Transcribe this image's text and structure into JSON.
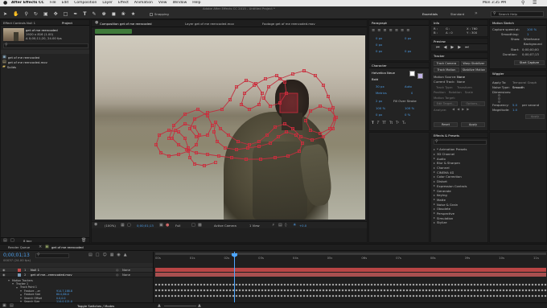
{
  "macbar": {
    "app_name": "After Effects CC",
    "menus": [
      "File",
      "Edit",
      "Composition",
      "Layer",
      "Effect",
      "Animation",
      "View",
      "Window",
      "Help"
    ],
    "clock": "Mon 3:35 PM",
    "window_title": "Adobe After Effects CC 2015 - Untitled Project *"
  },
  "toolbar": {
    "snapping_label": "Snapping",
    "workspaces": [
      "Essentials",
      "Standard"
    ],
    "search_help_placeholder": "Search Help"
  },
  "project_panel": {
    "tabs": [
      "Effect Controls Null 1",
      "Project"
    ],
    "item_name": "get of me reencoded",
    "item_details": [
      "1920 x 816 (1.00)",
      "Δ 0;00;11;20, 24.00 fps"
    ],
    "search_placeholder": "",
    "items": [
      {
        "icon": "comp",
        "name": "get of me reencoded"
      },
      {
        "icon": "footage",
        "name": "get of me reencoded.mov"
      },
      {
        "icon": "folder",
        "name": "Solids"
      }
    ],
    "bpc_label": "8 bpc"
  },
  "viewer": {
    "tabs": [
      "Composition get of me reencoded",
      "Layer get of me reencoded.mov",
      "Footage get of me reencoded.mov"
    ],
    "comp_chip": "get of me reencoded",
    "footer": {
      "zoom": "(100%)",
      "timecode": "0;00;01;13",
      "resolution": "Full",
      "camera": "Active Camera",
      "views": "1 View",
      "exposure": "+0.0"
    },
    "ruler_ticks": [
      "00s",
      "02s",
      "04s",
      "06s",
      "08s",
      "10s"
    ]
  },
  "paragraph_panel": {
    "title": "Paragraph",
    "fields": [
      "0 px",
      "0 px",
      "0 px",
      "0 px",
      "0 px"
    ]
  },
  "character_panel": {
    "title": "Character",
    "font": "Helvetica Neue",
    "style": "Bold",
    "size": "30 px",
    "leading": "Auto",
    "tracking": "Metrics",
    "tracking2": "0",
    "stroke": "2 px",
    "stroke_type": "Fill Over Stroke",
    "scales": [
      "100 %",
      "100 %"
    ],
    "baseline": "0 px",
    "tsume": "0 %"
  },
  "info_panel": {
    "title": "Info",
    "coords": [
      "X : 760",
      "Y : 300"
    ],
    "rgb": [
      "R :",
      "G :",
      "B :",
      "A : 0"
    ]
  },
  "preview_panel": {
    "title": "Preview"
  },
  "tracker_panel": {
    "title": "Tracker",
    "buttons": [
      "Track Camera",
      "Warp Stabilizer",
      "Track Motion",
      "Stabilize Motion"
    ],
    "motion_source_label": "Motion Source:",
    "motion_source_value": "None",
    "current_track_label": "Current Track:",
    "current_track_value": "None",
    "track_type_label": "Track Type:",
    "track_type_value": "Transform",
    "checks": [
      "Position",
      "Rotation",
      "Scale"
    ],
    "motion_target_label": "Motion Target:",
    "edit_target": "Edit Target...",
    "options": "Options...",
    "analyze_label": "Analyze:",
    "reset": "Reset",
    "apply": "Apply"
  },
  "effects_panel": {
    "title": "Effects & Presets",
    "items": [
      "* Animation Presets",
      "3D Channel",
      "Audio",
      "Blur & Sharpen",
      "Channel",
      "CINEMA 4D",
      "Color Correction",
      "Distort",
      "Expression Controls",
      "Generate",
      "Keying",
      "Matte",
      "Noise & Grain",
      "Obsolete",
      "Perspective",
      "Simulation",
      "Stylize"
    ]
  },
  "motion_sketch": {
    "title": "Motion Sketch",
    "capture_speed_label": "Capture speed at:",
    "capture_speed_value": "100 %",
    "smoothing_label": "Smoothing:",
    "smoothing_value": "1",
    "show_label": "Show:",
    "show_options": [
      "Wireframe",
      "Background"
    ],
    "start_label": "Start:",
    "start_value": "0;00;00;00",
    "duration_label": "Duration:",
    "duration_value": "0;00;07;13",
    "start_capture": "Start Capture"
  },
  "wiggler": {
    "title": "Wiggler",
    "apply_to_label": "Apply To:",
    "apply_to_value": "Temporal Graph",
    "noise_type_label": "Noise Type:",
    "noise_type_value": "Smooth",
    "dimensions_label": "Dimensions:",
    "frequency_label": "Frequency:",
    "frequency_value": "5.0",
    "frequency_unit": "per second",
    "magnitude_label": "Magnitude:",
    "magnitude_value": "1.0",
    "apply": "Apply"
  },
  "timeline": {
    "tabs": [
      "Render Queue",
      "get of me reencoded"
    ],
    "timecode": "0;00;01;13",
    "timecode_sub": "00037 (24.00 fps)",
    "search_placeholder": "",
    "layers": [
      {
        "num": "1",
        "name": "Null 1",
        "mode": "None",
        "color": "#c24a4a"
      },
      {
        "num": "2",
        "name": "get of me...reencoded.mov",
        "mode": "None",
        "color": "#7a9bb5"
      }
    ],
    "tracker_rows": [
      {
        "indent": 2,
        "label": "Motion Trackers",
        "value": ""
      },
      {
        "indent": 3,
        "label": "Tracker 1",
        "value": ""
      },
      {
        "indent": 4,
        "label": "Track Point 1",
        "value": ""
      },
      {
        "indent": 5,
        "label": "Feature ...er",
        "value": "914.7,188.8"
      },
      {
        "indent": 5,
        "label": "Feature Size",
        "value": "60.0,66.0"
      },
      {
        "indent": 5,
        "label": "Search Offset",
        "value": "0.0,0.0"
      },
      {
        "indent": 5,
        "label": "Search Size",
        "value": "114.0,121.0"
      }
    ],
    "ruler": [
      "00s",
      "01s",
      "02s",
      "03s",
      "04s",
      "05s",
      "06s",
      "07s",
      "08s",
      "09s",
      "10s",
      "11s"
    ],
    "footer_label": "Toggle Switches / Modes"
  }
}
